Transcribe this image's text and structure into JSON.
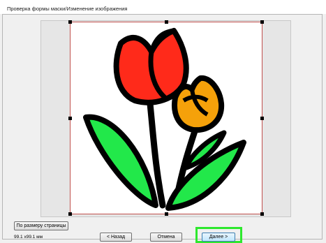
{
  "window": {
    "title": "Проверка формы маски/Изменение изображения"
  },
  "image": {
    "icon": "tulip-drawing",
    "petal_color_red": "#ff2a1a",
    "petal_color_orange": "#f5a10a",
    "leaf_color": "#22e84a",
    "outline_color": "#000000"
  },
  "controls": {
    "fit_page_label": "По размеру страницы",
    "size_text": "99.1 x99.1 мм",
    "back_label": "< Назад",
    "cancel_label": "Отмена",
    "next_label": "Далее >"
  },
  "colors": {
    "highlight": "#2ee82e",
    "selection_border": "#c0504d"
  }
}
